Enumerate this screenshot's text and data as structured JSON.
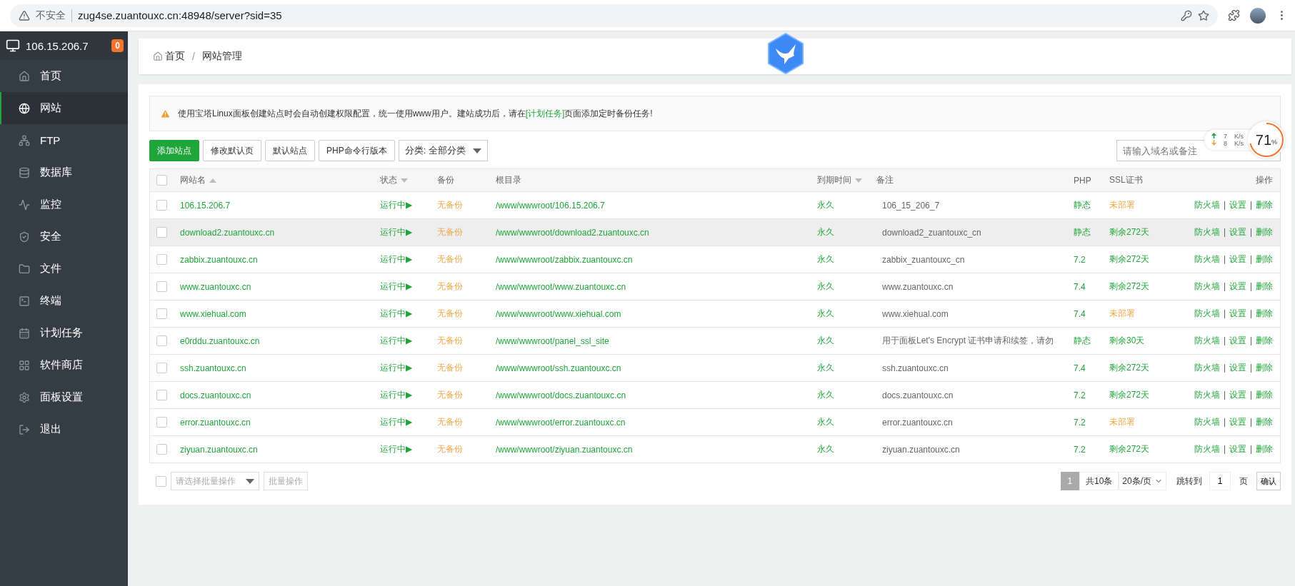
{
  "browser": {
    "security": "不安全",
    "url": "zug4se.zuantouxc.cn:48948/server?sid=35"
  },
  "sidebar": {
    "server": "106.15.206.7",
    "badge": "0",
    "items": [
      {
        "label": "首页",
        "selected": false
      },
      {
        "label": "网站",
        "selected": true
      },
      {
        "label": "FTP",
        "selected": false
      },
      {
        "label": "数据库",
        "selected": false
      },
      {
        "label": "监控",
        "selected": false
      },
      {
        "label": "安全",
        "selected": false
      },
      {
        "label": "文件",
        "selected": false
      },
      {
        "label": "终端",
        "selected": false
      },
      {
        "label": "计划任务",
        "selected": false
      },
      {
        "label": "软件商店",
        "selected": false
      },
      {
        "label": "面板设置",
        "selected": false
      },
      {
        "label": "退出",
        "selected": false
      }
    ]
  },
  "breadcrumb": [
    "首页",
    "网站管理"
  ],
  "breadcrumb_separator": "/",
  "alert": {
    "before": "使用宝塔Linux面板创建站点时会自动创建权限配置，统一使用www用户。建站成功后，请在",
    "link": "[计划任务]",
    "after": "页面添加定时备份任务!"
  },
  "toolbar": {
    "buttons": [
      {
        "label": "添加站点",
        "kind": "primary"
      },
      {
        "label": "修改默认页",
        "kind": "default"
      },
      {
        "label": "默认站点",
        "kind": "default"
      },
      {
        "label": "PHP命令行版本",
        "kind": "default"
      }
    ],
    "category": "分类: 全部分类",
    "search_placeholder": "请输入域名或备注"
  },
  "speed": {
    "up": "7",
    "up_unit": "K/s",
    "down": "8",
    "down_unit": "K/s",
    "load": "71",
    "load_unit": "%"
  },
  "table": {
    "header_checked": false,
    "columns": [
      {
        "label": "网站名",
        "sort_up": true
      },
      {
        "label": "状态",
        "sort_down": true
      },
      {
        "label": "备份"
      },
      {
        "label": "根目录"
      },
      {
        "label": "到期时间",
        "sort_down": true
      },
      {
        "label": "备注"
      },
      {
        "label": "PHP"
      },
      {
        "label": "SSL证书"
      },
      {
        "label": "操作"
      }
    ],
    "rows": [
      {
        "checked": false,
        "hovered": false,
        "name": "106.15.206.7",
        "status": "运行中▶",
        "backup": "无备份",
        "root": "/www/wwwroot/106.15.206.7",
        "expire": "永久",
        "note": "106_15_206_7",
        "php": "静态",
        "ssl": "未部署",
        "ssl_deployed": false,
        "actions": [
          "防火墙",
          "设置",
          "删除"
        ]
      },
      {
        "checked": false,
        "hovered": true,
        "name": "download2.zuantouxc.cn",
        "status": "运行中▶",
        "backup": "无备份",
        "root": "/www/wwwroot/download2.zuantouxc.cn",
        "expire": "永久",
        "note": "download2_zuantouxc_cn",
        "php": "静态",
        "ssl": "剩余272天",
        "ssl_deployed": true,
        "actions": [
          "防火墙",
          "设置",
          "删除"
        ]
      },
      {
        "checked": false,
        "hovered": false,
        "name": "zabbix.zuantouxc.cn",
        "status": "运行中▶",
        "backup": "无备份",
        "root": "/www/wwwroot/zabbix.zuantouxc.cn",
        "expire": "永久",
        "note": "zabbix_zuantouxc_cn",
        "php": "7.2",
        "ssl": "剩余272天",
        "ssl_deployed": true,
        "actions": [
          "防火墙",
          "设置",
          "删除"
        ]
      },
      {
        "checked": false,
        "hovered": false,
        "name": "www.zuantouxc.cn",
        "status": "运行中▶",
        "backup": "无备份",
        "root": "/www/wwwroot/www.zuantouxc.cn",
        "expire": "永久",
        "note": "www.zuantouxc.cn",
        "php": "7.4",
        "ssl": "剩余272天",
        "ssl_deployed": true,
        "actions": [
          "防火墙",
          "设置",
          "删除"
        ]
      },
      {
        "checked": false,
        "hovered": false,
        "name": "www.xiehual.com",
        "status": "运行中▶",
        "backup": "无备份",
        "root": "/www/wwwroot/www.xiehual.com",
        "expire": "永久",
        "note": "www.xiehual.com",
        "php": "7.4",
        "ssl": "未部署",
        "ssl_deployed": false,
        "actions": [
          "防火墙",
          "设置",
          "删除"
        ]
      },
      {
        "checked": false,
        "hovered": false,
        "name": "e0rddu.zuantouxc.cn",
        "status": "运行中▶",
        "backup": "无备份",
        "root": "/www/wwwroot/panel_ssl_site",
        "expire": "永久",
        "note": "用于面板Let's Encrypt 证书申请和续签，请勿",
        "php": "静态",
        "ssl": "剩余30天",
        "ssl_deployed": true,
        "actions": [
          "防火墙",
          "设置",
          "删除"
        ]
      },
      {
        "checked": false,
        "hovered": false,
        "name": "ssh.zuantouxc.cn",
        "status": "运行中▶",
        "backup": "无备份",
        "root": "/www/wwwroot/ssh.zuantouxc.cn",
        "expire": "永久",
        "note": "ssh.zuantouxc.cn",
        "php": "7.4",
        "ssl": "剩余272天",
        "ssl_deployed": true,
        "actions": [
          "防火墙",
          "设置",
          "删除"
        ]
      },
      {
        "checked": false,
        "hovered": false,
        "name": "docs.zuantouxc.cn",
        "status": "运行中▶",
        "backup": "无备份",
        "root": "/www/wwwroot/docs.zuantouxc.cn",
        "expire": "永久",
        "note": "docs.zuantouxc.cn",
        "php": "7.2",
        "ssl": "剩余272天",
        "ssl_deployed": true,
        "actions": [
          "防火墙",
          "设置",
          "删除"
        ]
      },
      {
        "checked": false,
        "hovered": false,
        "name": "error.zuantouxc.cn",
        "status": "运行中▶",
        "backup": "无备份",
        "root": "/www/wwwroot/error.zuantouxc.cn",
        "expire": "永久",
        "note": "error.zuantouxc.cn",
        "php": "7.2",
        "ssl": "未部署",
        "ssl_deployed": false,
        "actions": [
          "防火墙",
          "设置",
          "删除"
        ]
      },
      {
        "checked": false,
        "hovered": false,
        "name": "ziyuan.zuantouxc.cn",
        "status": "运行中▶",
        "backup": "无备份",
        "root": "/www/wwwroot/ziyuan.zuantouxc.cn",
        "expire": "永久",
        "note": "ziyuan.zuantouxc.cn",
        "php": "7.2",
        "ssl": "剩余272天",
        "ssl_deployed": true,
        "actions": [
          "防火墙",
          "设置",
          "删除"
        ]
      }
    ]
  },
  "footer": {
    "checked": false,
    "batch_placeholder": "请选择批量操作",
    "batch_button": "批量操作",
    "page": "1",
    "total": "共10条",
    "per_page": "20条/页",
    "jump_label": "跳转到",
    "jump_value": "1",
    "page_unit": "页",
    "confirm": "确认"
  }
}
